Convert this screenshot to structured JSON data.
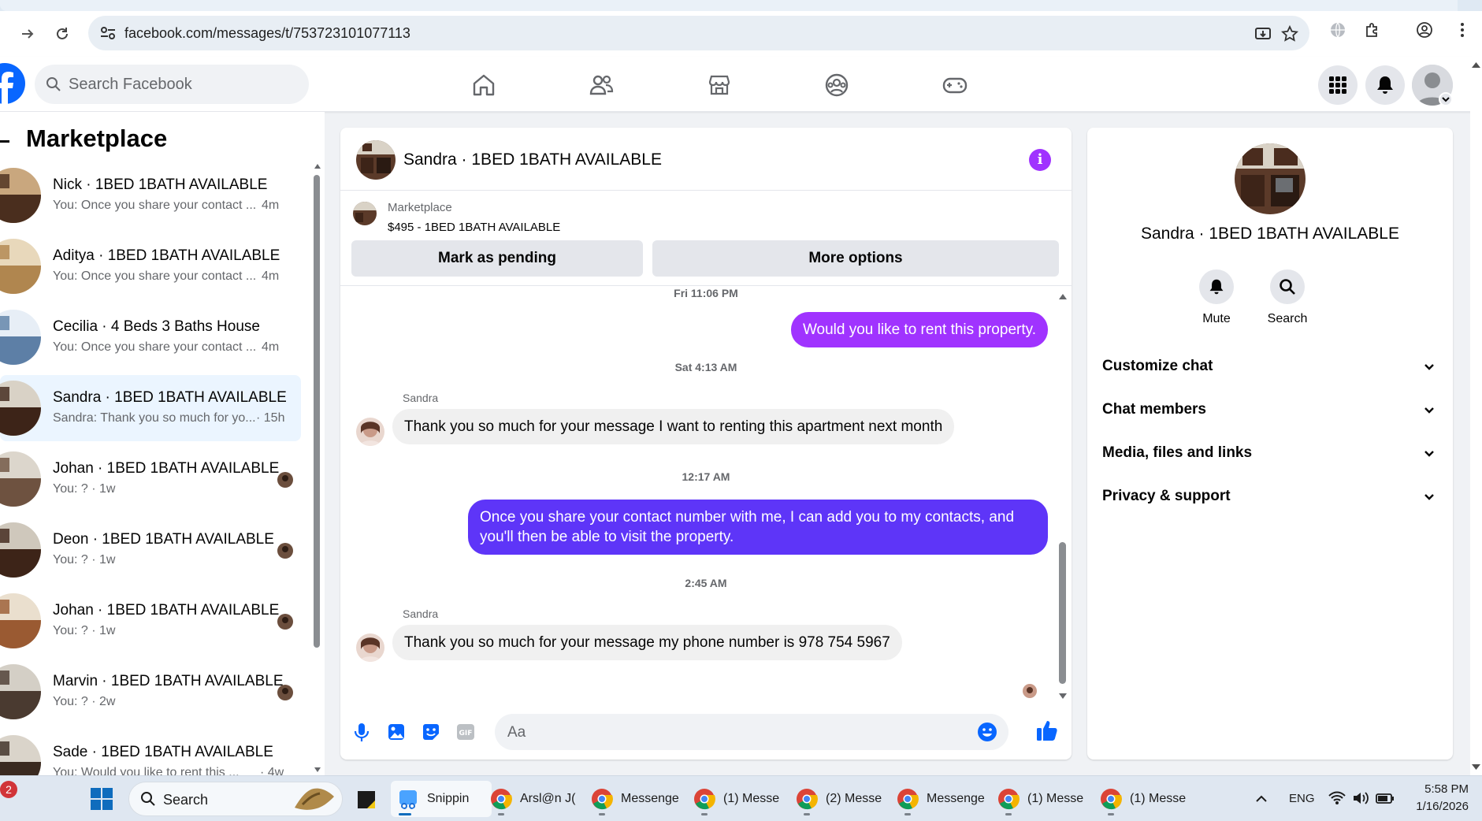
{
  "browser": {
    "url": "facebook.com/messages/t/753723101077113"
  },
  "fb_nav": {
    "search_placeholder": "Search Facebook"
  },
  "sidebar": {
    "title": "Marketplace",
    "conversations": [
      {
        "name": "Nick · 1BED 1BATH AVAILABLE",
        "preview": "You: Once you share your contact ...",
        "time": "4m"
      },
      {
        "name": "Aditya · 1BED 1BATH AVAILABLE",
        "preview": "You: Once you share your contact ...",
        "time": "4m"
      },
      {
        "name": "Cecilia · 4 Beds 3 Baths House",
        "preview": "You: Once you share your contact ...",
        "time": "4m"
      },
      {
        "name": "Sandra · 1BED 1BATH AVAILABLE",
        "preview": "Sandra: Thank you so much for yo...",
        "time": "· 15h"
      },
      {
        "name": "Johan · 1BED 1BATH AVAILABLE",
        "preview": "You: ? · 1w",
        "time": ""
      },
      {
        "name": "Deon · 1BED 1BATH AVAILABLE",
        "preview": "You: ? · 1w",
        "time": ""
      },
      {
        "name": "Johan · 1BED 1BATH AVAILABLE",
        "preview": "You: ? · 1w",
        "time": ""
      },
      {
        "name": "Marvin · 1BED 1BATH AVAILABLE",
        "preview": "You: ? · 2w",
        "time": ""
      },
      {
        "name": "Sade · 1BED 1BATH AVAILABLE",
        "preview": "You: Would you like to rent this ...",
        "time": "· 4w"
      }
    ]
  },
  "chat": {
    "title": "Sandra · 1BED 1BATH AVAILABLE",
    "listing_source": "Marketplace",
    "listing_title": "$495 - 1BED 1BATH AVAILABLE",
    "mark_pending": "Mark as pending",
    "more_options": "More options",
    "messages": [
      {
        "timestamp": "Fri 11:06 PM"
      },
      {
        "from": "me",
        "text": "Would you like to rent this property."
      },
      {
        "timestamp": "Sat 4:13 AM"
      },
      {
        "from": "Sandra",
        "sender": "Sandra",
        "text": "Thank you so much for your message I want to renting this apartment next month"
      },
      {
        "timestamp": "12:17 AM"
      },
      {
        "from": "me",
        "text": "Once you share your contact number with me, I can add you to my contacts, and you'll then be able to visit the property."
      },
      {
        "timestamp": "2:45 AM"
      },
      {
        "from": "Sandra",
        "sender": "Sandra",
        "text": "Thank you so much for your message my phone number is 978 754 5967"
      }
    ],
    "composer_placeholder": "Aa"
  },
  "info_panel": {
    "name": "Sandra · 1BED 1BATH AVAILABLE",
    "mute_label": "Mute",
    "search_label": "Search",
    "rows": [
      "Customize chat",
      "Chat members",
      "Media, files and links",
      "Privacy & support"
    ]
  },
  "taskbar": {
    "badge": "2",
    "search": "Search",
    "apps": [
      {
        "label": "Snippin",
        "icon": "snipping-tool-icon"
      },
      {
        "label": "Arsl@n J(",
        "icon": "chrome-icon"
      },
      {
        "label": "Messenge",
        "icon": "chrome-icon"
      },
      {
        "label": "(1) Messe",
        "icon": "chrome-icon"
      },
      {
        "label": "(2) Messe",
        "icon": "chrome-icon"
      },
      {
        "label": "Messenge",
        "icon": "chrome-icon"
      },
      {
        "label": "(1) Messe",
        "icon": "chrome-icon"
      },
      {
        "label": "(1) Messe",
        "icon": "chrome-icon"
      }
    ],
    "lang": "ENG",
    "time": "5:58 PM",
    "date": "1/16/2026"
  },
  "colors": {
    "fb_blue": "#0866ff",
    "bubble_purple": "#a033ff",
    "bubble_indigo": "#5e35f8",
    "accent_purple": "#a033ff"
  }
}
